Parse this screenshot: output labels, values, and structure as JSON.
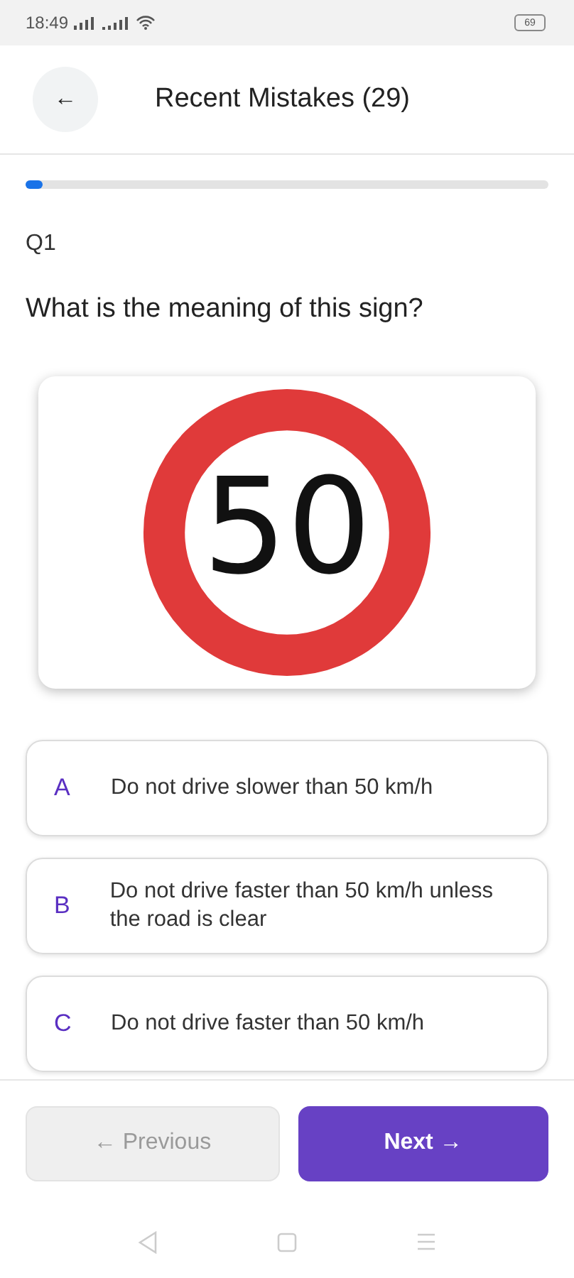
{
  "status_bar": {
    "time": "18:49",
    "battery": "69"
  },
  "header": {
    "back": "←",
    "title": "Recent Mistakes (29)"
  },
  "progress": {
    "level": 0.02
  },
  "question": {
    "number": "Q1",
    "text": "What is the meaning of this sign?",
    "sign": {
      "kind": "speed-limit",
      "value": "50"
    }
  },
  "options": [
    {
      "letter": "A",
      "text": "Do not drive slower than 50 km/h",
      "selected": false
    },
    {
      "letter": "B",
      "text": "Do not drive faster than 50 km/h unless the road is clear",
      "selected": false
    },
    {
      "letter": "C",
      "text": "Do not drive faster than 50 km/h",
      "selected": false
    }
  ],
  "buttons": [
    {
      "label": "← Previous",
      "kind": "secondary",
      "disabled": true
    },
    {
      "label": "Next →",
      "kind": "primary",
      "disabled": false
    }
  ]
}
